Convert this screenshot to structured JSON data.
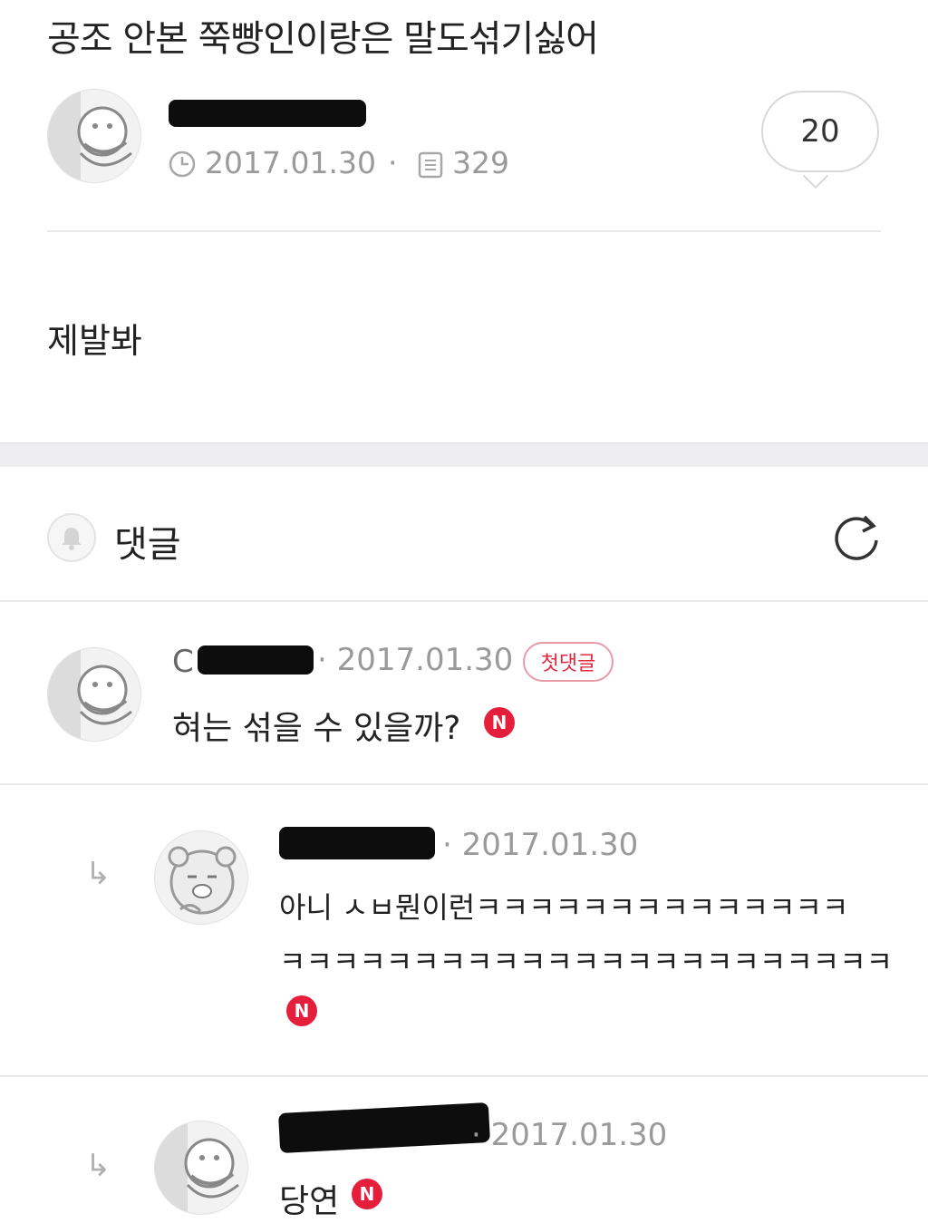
{
  "post": {
    "title": "공조 안본 쭉빵인이랑은 말도섞기싫어",
    "date": "2017.01.30",
    "views": "329",
    "comment_count": "20",
    "body": "제발봐"
  },
  "comments_section": {
    "title": "댓글"
  },
  "comments": [
    {
      "author_prefix": "C",
      "date": "2017.01.30",
      "badge": "첫댓글",
      "text": "혀는 섞을 수 있을까?",
      "new_badge": "N"
    },
    {
      "date": "2017.01.30",
      "line1": "아니 ㅅㅂ뭔이런ㅋㅋㅋㅋㅋㅋㅋㅋㅋㅋㅋㅋㅋㅋ",
      "line2": "ㅋㅋㅋㅋㅋㅋㅋㅋㅋㅋㅋㅋㅋㅋㅋㅋㅋㅋㅋㅋㅋㅋㅋ",
      "new_badge": "N"
    },
    {
      "date": "2017.01.30",
      "text": "당연",
      "new_badge": "N"
    }
  ],
  "colors": {
    "accent": "#e51f3b",
    "meta": "#9a9a9a",
    "divider": "#e9e9e9"
  },
  "icons": [
    "clock-icon",
    "document-icon",
    "bell-icon",
    "refresh-icon",
    "reply-arrow-icon"
  ]
}
